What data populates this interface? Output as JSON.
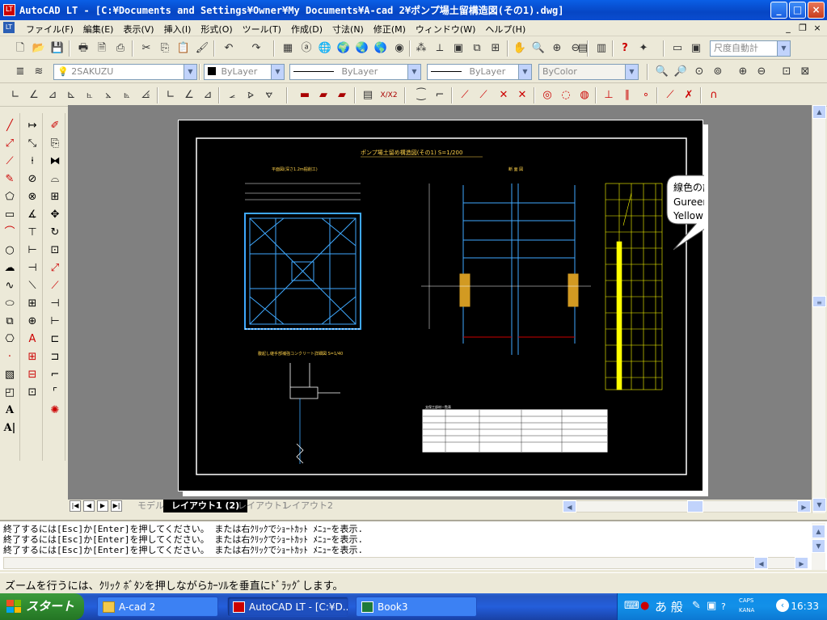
{
  "window": {
    "title": "AutoCAD LT - [C:¥Documents and Settings¥Owner¥My Documents¥A-cad 2¥ポンプ場土留構造図(その1).dwg]",
    "minimize": "_",
    "maximize": "□",
    "close": "×"
  },
  "menu": {
    "items": [
      "ファイル(F)",
      "編集(E)",
      "表示(V)",
      "挿入(I)",
      "形式(O)",
      "ツール(T)",
      "作成(D)",
      "寸法(N)",
      "修正(M)",
      "ウィンドウ(W)",
      "ヘルプ(H)"
    ],
    "doc_min": "_",
    "doc_restore": "❐",
    "doc_close": "×"
  },
  "toolbar_std": {
    "dimstyle_combo": "尺度自動計"
  },
  "toolbar_layer": {
    "layer_combo": "2SAKUZU",
    "color_combo": "ByLayer",
    "linetype_combo": "ByLayer",
    "lineweight_combo": "ByLayer",
    "plotstyle_combo": "ByColor"
  },
  "tabs": {
    "nav": [
      "|◀",
      "◀",
      "▶",
      "▶|"
    ],
    "items": [
      "モデル",
      "レイアウト1 (2)",
      "レイアウト1",
      "レイアウト2"
    ],
    "active_index": 1
  },
  "drawing": {
    "main_title": "ポンプ場土留め構造図(その1)  S=1/200",
    "plan_title": "平面図(深さ1.2m掘削工)",
    "section_title": "断 面 図",
    "detail_title": "腹起し継手部補強コンクリート詳細図 S=1/40",
    "table_title": "支保工部材一覧表",
    "callout": [
      "線色の設定を",
      "Gureenから",
      "Yellowに変更"
    ]
  },
  "command": {
    "lines": [
      "終了するには[Esc]か[Enter]を押してください。 または右ｸﾘｯｸでｼｮｰﾄｶｯﾄ ﾒﾆｭｰを表示.",
      "終了するには[Esc]か[Enter]を押してください。 または右ｸﾘｯｸでｼｮｰﾄｶｯﾄ ﾒﾆｭｰを表示.",
      "終了するには[Esc]か[Enter]を押してください。 または右ｸﾘｯｸでｼｮｰﾄｶｯﾄ ﾒﾆｭｰを表示."
    ]
  },
  "status": {
    "text": "ズームを行うには、ｸﾘｯｸ ﾎﾞﾀﾝを押しながらｶｰｿﾙを垂直にﾄﾞﾗｯｸﾞします。"
  },
  "taskbar": {
    "start": "スタート",
    "tasks": [
      {
        "label": "A-cad 2",
        "active": false
      },
      {
        "label": "AutoCAD LT - [C:¥D...",
        "active": true
      },
      {
        "label": "Book3",
        "active": false
      }
    ],
    "ime": "あ 般",
    "caps": "CAPS",
    "kana": "KANA",
    "clock": "16:33"
  },
  "colors": {
    "title_blue": "#0646c4",
    "paper": "#000000",
    "model_bg": "#808080",
    "accent_yellow": "#ffff00",
    "accent_cyan": "#3fa9ff",
    "task_active": "#1e4fbe",
    "tray_blue": "#1290e8"
  }
}
